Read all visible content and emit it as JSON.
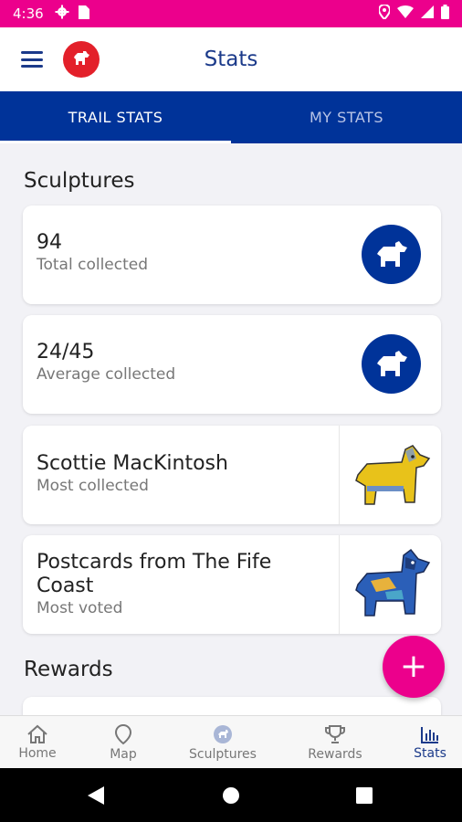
{
  "status_bar": {
    "time": "4:36"
  },
  "app_bar": {
    "title": "Stats"
  },
  "tabs": [
    {
      "label": "TRAIL STATS",
      "active": true
    },
    {
      "label": "MY STATS",
      "active": false
    }
  ],
  "sections": {
    "sculptures_title": "Sculptures",
    "rewards_title": "Rewards"
  },
  "cards": [
    {
      "value": "94",
      "caption": "Total collected",
      "icon": "scottie-dog-icon"
    },
    {
      "value": "24/45",
      "caption": "Average collected",
      "icon": "scottie-dog-icon"
    },
    {
      "value": "Scottie MacKintosh",
      "caption": "Most collected",
      "image": "yellow-scottie-sculpture"
    },
    {
      "value": "Postcards from The Fife Coast",
      "caption": "Most voted",
      "image": "blue-scottie-sculpture"
    }
  ],
  "fab": {
    "label": "+"
  },
  "bottom_nav": [
    {
      "label": "Home",
      "icon": "home-icon"
    },
    {
      "label": "Map",
      "icon": "map-pin-icon"
    },
    {
      "label": "Sculptures",
      "icon": "sculptures-icon"
    },
    {
      "label": "Rewards",
      "icon": "trophy-icon"
    },
    {
      "label": "Stats",
      "icon": "bar-chart-icon",
      "active": true
    }
  ],
  "colors": {
    "accent": "#ec008c",
    "brand": "#003399",
    "logo": "#e3202a"
  }
}
